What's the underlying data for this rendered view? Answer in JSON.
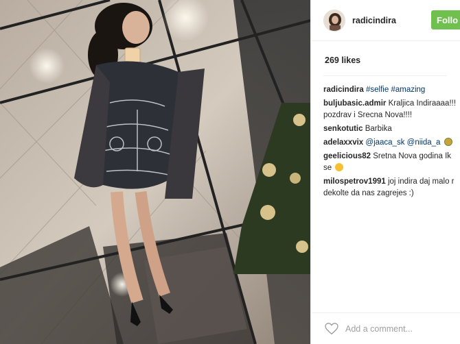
{
  "post": {
    "username": "radicindira",
    "follow_label": "Follo",
    "likes_text": "269 likes",
    "caption": {
      "user": "radicindira",
      "tags": [
        "#selfie",
        "#amazing"
      ]
    },
    "comments": [
      {
        "user": "buljubasic.admir",
        "text_line1": "Kraljica Indiraaaa!!!",
        "text_line2": "pozdrav i Srecna Nova!!!!"
      },
      {
        "user": "senkotutic",
        "text_line1": "Barbika"
      },
      {
        "user": "adelaxxvix",
        "mentions": [
          "@jaaca_sk",
          "@niida_a"
        ],
        "emoji": "cat-face"
      },
      {
        "user": "geelicious82",
        "text_line1": "Sretna Nova godina Ik",
        "text_line2": "se",
        "emoji": "face"
      },
      {
        "user": "milospetrov1991",
        "text_line1": "joj indira daj malo r",
        "text_line2": "dekolte da nas zagrejes :)"
      }
    ],
    "comment_input": {
      "placeholder": "Add a comment..."
    },
    "icons": {
      "like": "heart-icon"
    },
    "colors": {
      "follow": "#70c050",
      "link": "#003569",
      "text": "#262626"
    }
  }
}
